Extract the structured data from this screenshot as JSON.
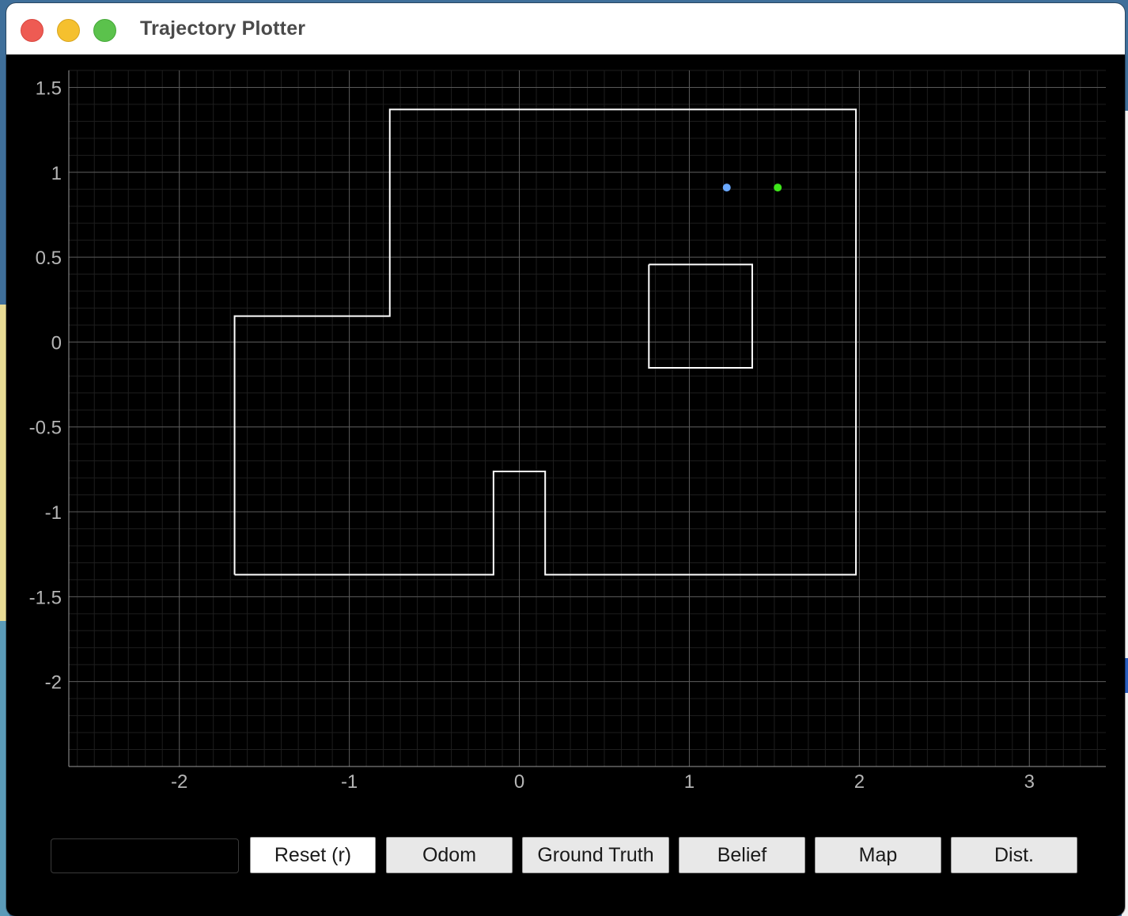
{
  "window": {
    "title": "Trajectory Plotter"
  },
  "buttons": {
    "reset": "Reset (r)",
    "odom": "Odom",
    "ground_truth": "Ground Truth",
    "belief": "Belief",
    "map": "Map",
    "dist": "Dist."
  },
  "input": {
    "value": ""
  },
  "colors": {
    "background": "#000000",
    "grid_major": "#5a5a5a",
    "grid_minor": "#1e1e1e",
    "map_lines": "#ffffff",
    "odom_point": "#6aa8ff",
    "ground_truth_point": "#3ee61a"
  },
  "chart_data": {
    "type": "line",
    "xlim": [
      -2.65,
      3.45
    ],
    "ylim": [
      -2.5,
      1.6
    ],
    "xticks": [
      -2,
      -1,
      0,
      1,
      2,
      3
    ],
    "xtick_labels": [
      "-2",
      "-1",
      "0",
      "1",
      "2",
      "3"
    ],
    "yticks": [
      1.5,
      1,
      0.5,
      0,
      -0.5,
      -1,
      -1.5,
      -2
    ],
    "ytick_labels": [
      "1.5",
      "1",
      "0.5",
      "0",
      "-0.5",
      "-1",
      "-1.5",
      "-2"
    ],
    "grid": true,
    "series": [
      {
        "kind": "map-outline",
        "points": [
          [
            -1.675,
            -1.37
          ],
          [
            -1.675,
            0.153
          ],
          [
            -0.762,
            0.153
          ],
          [
            -0.762,
            1.37
          ],
          [
            1.98,
            1.37
          ],
          [
            1.98,
            -1.37
          ],
          [
            0.152,
            -1.37
          ],
          [
            0.152,
            -0.762
          ],
          [
            -0.152,
            -0.762
          ],
          [
            -0.152,
            -1.37
          ],
          [
            -1.675,
            -1.37
          ]
        ]
      },
      {
        "kind": "map-obstacle",
        "points": [
          [
            0.762,
            0.457
          ],
          [
            1.37,
            0.457
          ],
          [
            1.37,
            -0.152
          ],
          [
            0.762,
            -0.152
          ],
          [
            0.762,
            0.457
          ]
        ]
      },
      {
        "kind": "odom",
        "points": [
          [
            1.22,
            0.91
          ]
        ]
      },
      {
        "kind": "ground-truth",
        "points": [
          [
            1.52,
            0.91
          ]
        ]
      }
    ]
  }
}
